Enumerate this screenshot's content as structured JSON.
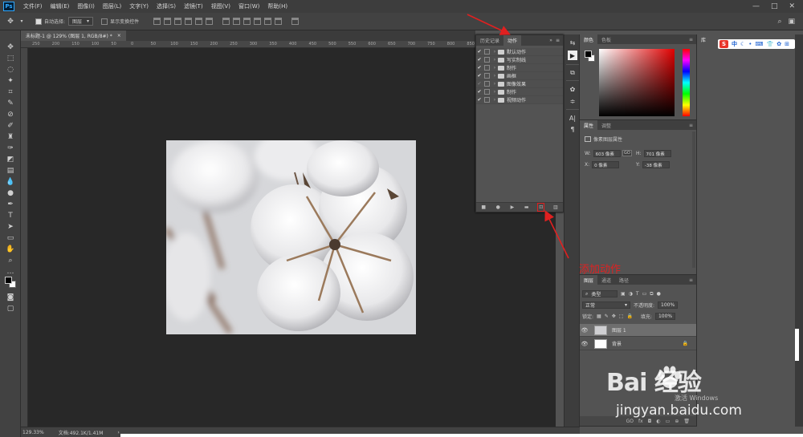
{
  "menubar": {
    "logo": "Ps",
    "items": [
      "文件(F)",
      "编辑(E)",
      "图像(I)",
      "图层(L)",
      "文字(Y)",
      "选择(S)",
      "滤镜(T)",
      "视图(V)",
      "窗口(W)",
      "帮助(H)"
    ],
    "controls": [
      "—",
      "□",
      "✕"
    ]
  },
  "options": {
    "auto_select_label": "自动选择:",
    "auto_select_value": "图层",
    "show_transform_label": "显示变换控件"
  },
  "document": {
    "tab_label": "未标题-1 @ 129% (图层 1, RGB/8#) *",
    "tab_close": "×",
    "zoom": "129.33%",
    "doc_info": "文档:492.1K/1.41M",
    "status_arrow": "›"
  },
  "rulers": {
    "top": [
      "250",
      "200",
      "150",
      "100",
      "50",
      "0",
      "50",
      "100",
      "150",
      "200",
      "250",
      "300",
      "350",
      "400",
      "450",
      "500",
      "550",
      "600",
      "650",
      "700",
      "750",
      "800",
      "850"
    ]
  },
  "actions_panel": {
    "tabs": [
      "历史记录",
      "动作"
    ],
    "active_tab": "动作",
    "header_icons": [
      "»",
      "≡"
    ],
    "rows": [
      {
        "label": "默认动作",
        "checked": true
      },
      {
        "label": "写实制线",
        "checked": true
      },
      {
        "label": "制作",
        "checked": true
      },
      {
        "label": "画框",
        "checked": true
      },
      {
        "label": "图像效果",
        "checked": false
      },
      {
        "label": "制作",
        "checked": true
      },
      {
        "label": "视频动作",
        "checked": true
      }
    ]
  },
  "color_panel": {
    "tabs": [
      "颜色",
      "色板"
    ],
    "menu": "≡"
  },
  "properties_panel": {
    "tabs": [
      "属性",
      "调整"
    ],
    "title": "像素图层属性",
    "w_label": "W:",
    "w_value": "603 像素",
    "h_label": "H:",
    "h_value": "701 像素",
    "x_label": "X:",
    "x_value": "0 像素",
    "y_label": "Y:",
    "y_value": "-38 像素",
    "link_icon": "GO"
  },
  "layers_panel": {
    "tabs": [
      "图层",
      "通道",
      "路径"
    ],
    "kind_label": "类型",
    "blend_mode": "正常",
    "opacity_label": "不透明度:",
    "opacity_value": "100%",
    "lock_label": "锁定:",
    "fill_label": "填充:",
    "fill_value": "100%",
    "layers": [
      {
        "name": "图层 1",
        "selected": true
      },
      {
        "name": "背景",
        "selected": false,
        "locked": true
      }
    ],
    "footer_icons": [
      "GO",
      "fx",
      "◘",
      "◐",
      "▭",
      "⊕",
      "🗑"
    ]
  },
  "library": {
    "tab": "库"
  },
  "sogou": {
    "letter": "S",
    "text": "中",
    "icons": [
      "☾",
      "•",
      "⌨",
      "👕",
      "✿",
      "⊞"
    ]
  },
  "annotation": {
    "text": "添加动作",
    "color": "#e02020"
  },
  "watermark": {
    "brand": "Bai  经验",
    "url": "jingyan.baidu.com",
    "sub": "激活 Windows"
  },
  "colors": {
    "app_bg": "#535353",
    "canvas_bg": "#282828",
    "accent_red": "#e02020"
  }
}
